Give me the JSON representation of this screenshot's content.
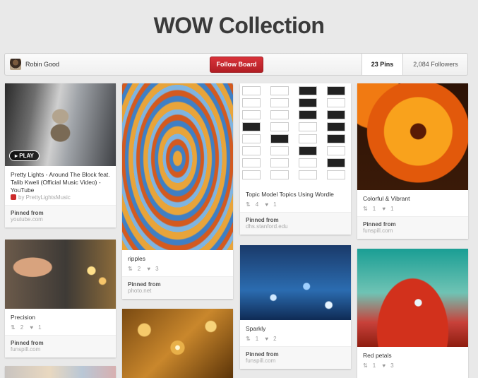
{
  "board": {
    "title": "WOW Collection",
    "owner": "Robin Good",
    "follow_label": "Follow Board",
    "pins_count": "23 Pins",
    "followers_count": "2,084 Followers"
  },
  "pins": {
    "p1": {
      "desc": "Pretty Lights - Around The Block feat. Talib Kweli (Official Music Video) - YouTube",
      "play": "▸ PLAY",
      "via": "by PrettyLightsMusic",
      "pinned_from": "Pinned from",
      "source": "youtube.com"
    },
    "p2": {
      "desc": "Precision",
      "repins": "2",
      "likes": "1",
      "pinned_from": "Pinned from",
      "source": "funspill.com"
    },
    "p3": {
      "desc": "ripples",
      "repins": "2",
      "likes": "3",
      "pinned_from": "Pinned from",
      "source": "photo.net"
    },
    "p4": {
      "desc": "Topic Model Topics Using Wordle",
      "repins": "4",
      "likes": "1",
      "pinned_from": "Pinned from",
      "source": "dhs.stanford.edu"
    },
    "p5": {
      "desc": "Sparkly",
      "repins": "1",
      "likes": "2",
      "pinned_from": "Pinned from",
      "source": "funspill.com"
    },
    "p6": {
      "desc": "Colorful & Vibrant",
      "repins": "1",
      "likes": "1",
      "pinned_from": "Pinned from",
      "source": "funspill.com"
    },
    "p7": {
      "desc": "Red petals",
      "repins": "1",
      "likes": "3"
    }
  },
  "colors": {
    "follow_button": "#c8262d",
    "background": "#e9e9e9"
  }
}
